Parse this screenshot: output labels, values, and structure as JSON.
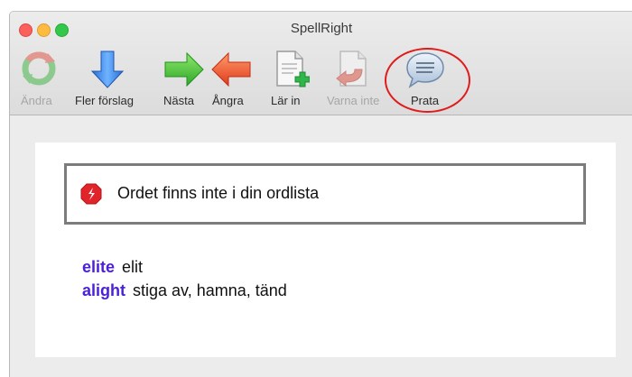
{
  "window": {
    "title": "SpellRight"
  },
  "toolbar": {
    "items": [
      {
        "label": "Ändra",
        "icon": "change-icon",
        "enabled": false
      },
      {
        "label": "Fler förslag",
        "icon": "arrow-down-icon",
        "enabled": true
      },
      {
        "label": "Nästa",
        "icon": "arrow-right-icon",
        "enabled": true
      },
      {
        "label": "Ångra",
        "icon": "arrow-left-icon",
        "enabled": true
      },
      {
        "label": "Lär in",
        "icon": "add-document-icon",
        "enabled": true
      },
      {
        "label": "Varna inte",
        "icon": "ignore-document-icon",
        "enabled": false
      },
      {
        "label": "Prata",
        "icon": "speech-bubble-icon",
        "enabled": true
      }
    ],
    "highlight_color": "#e01b1b"
  },
  "message": {
    "icon": "stop-sign-icon",
    "text": "Ordet finns inte i din ordlista"
  },
  "suggestions": [
    {
      "word": "elite",
      "translation": "elit"
    },
    {
      "word": "alight",
      "translation": "stiga av, hamna, tänd"
    }
  ],
  "colors": {
    "suggestion_word": "#4b20d8",
    "stop_icon": "#e0242a"
  }
}
